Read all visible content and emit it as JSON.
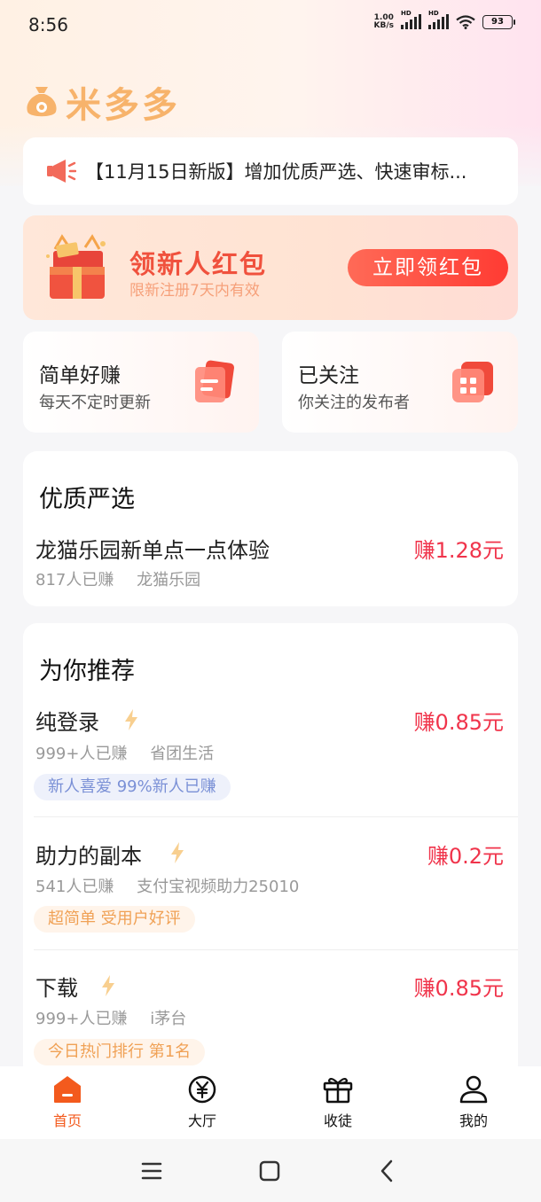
{
  "status_bar": {
    "time": "8:56",
    "net_speed_value": "1.00",
    "net_speed_unit": "KB/s",
    "sim1_label": "HD",
    "sim2_label": "HD",
    "battery": "93"
  },
  "brand": {
    "name": "米多多",
    "color": "#f7b36b"
  },
  "notice": {
    "text": "【11月15日新版】增加优质严选、快速审标..."
  },
  "new_user": {
    "title": "领新人红包",
    "subtitle": "限新注册7天内有效",
    "button": "立即领红包"
  },
  "quick_cards": [
    {
      "title": "简单好赚",
      "subtitle": "每天不定时更新",
      "icon": "doc-icon"
    },
    {
      "title": "已关注",
      "subtitle": "你关注的发布者",
      "icon": "grid-icon"
    }
  ],
  "premium": {
    "title": "优质严选",
    "task": {
      "title": "龙猫乐园新单点一点体验",
      "reward": "赚1.28元",
      "earned": "817人已赚",
      "publisher": "龙猫乐园"
    }
  },
  "recommend": {
    "title": "为你推荐",
    "tasks": [
      {
        "title": "纯登录",
        "reward": "赚0.85元",
        "earned": "999+人已赚",
        "publisher": "省团生活",
        "tag": "新人喜爱  99%新人已赚",
        "tag_style": "blue"
      },
      {
        "title": "助力的副本",
        "reward": "赚0.2元",
        "earned": "541人已赚",
        "publisher": "支付宝视频助力25010",
        "tag": "超简单  受用户好评",
        "tag_style": "orange"
      },
      {
        "title": "下载",
        "reward": "赚0.85元",
        "earned": "999+人已赚",
        "publisher": "i茅台",
        "tag": "今日热门排行 第1名",
        "tag_style": "orange"
      }
    ]
  },
  "tabbar": [
    {
      "label": "首页",
      "icon": "home-icon",
      "active": true
    },
    {
      "label": "大厅",
      "icon": "yuan-coin-icon",
      "active": false
    },
    {
      "label": "收徒",
      "icon": "gift-icon",
      "active": false
    },
    {
      "label": "我的",
      "icon": "user-icon",
      "active": false
    }
  ],
  "colors": {
    "accent": "#f35a1d",
    "reward": "#f0344b",
    "brand": "#f7b36b"
  }
}
